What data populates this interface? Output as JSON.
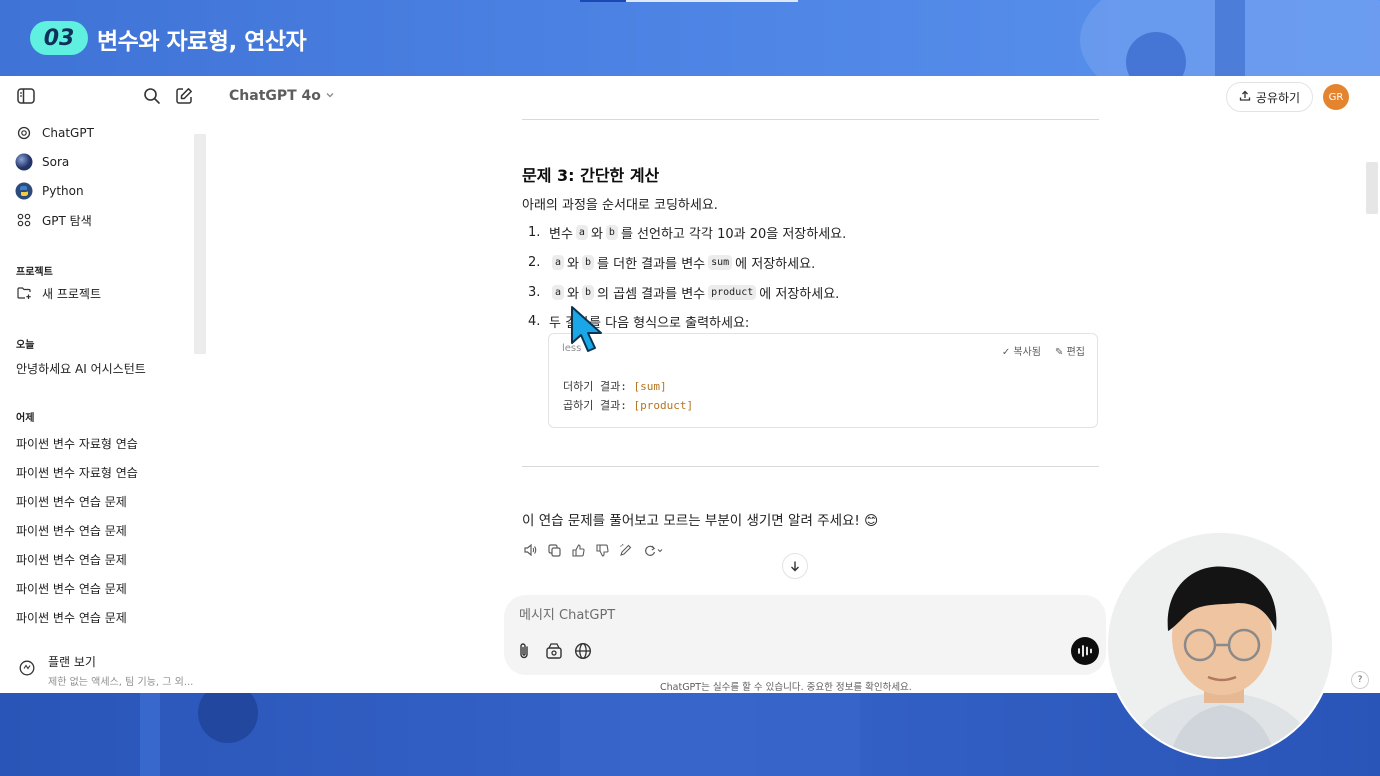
{
  "banner": {
    "badge": "03",
    "title": "변수와 자료형, 연산자"
  },
  "sidebar": {
    "items": [
      {
        "label": "ChatGPT",
        "icon": "openai-icon"
      },
      {
        "label": "Sora",
        "icon": "sora-icon"
      },
      {
        "label": "Python",
        "icon": "python-icon"
      },
      {
        "label": "GPT 탐색",
        "icon": "grid-icon"
      }
    ],
    "projects_heading": "프로젝트",
    "new_project": "새 프로젝트",
    "today_heading": "오늘",
    "today_items": [
      "안녕하세요 AI 어시스턴트"
    ],
    "yesterday_heading": "어제",
    "yesterday_items": [
      "파이썬 변수 자료형 연습",
      "파이썬 변수 자료형 연습",
      "파이썬 변수 연습 문제",
      "파이썬 변수 연습 문제",
      "파이썬 변수 연습 문제",
      "파이썬 변수 연습 문제",
      "파이썬 변수 연습 문제"
    ],
    "plan": {
      "title": "플랜 보기",
      "subtitle": "제한 없는 액세스, 팀 기능, 그 외..."
    }
  },
  "topbar": {
    "model": "ChatGPT 4o",
    "share": "공유하기",
    "avatar": "GR"
  },
  "content": {
    "heading": "문제 3: 간단한 계산",
    "intro": "아래의 과정을 순서대로 코딩하세요.",
    "steps": [
      {
        "num": "1.",
        "pre": "변수",
        "c1": "a",
        "mid": "와",
        "c2": "b",
        "post": "를 선언하고 각각 10과 20을 저장하세요."
      },
      {
        "num": "2.",
        "c1": "a",
        "mid": "와",
        "c2": "b",
        "post1": "를 더한 결과를 변수",
        "c3": "sum",
        "post2": "에 저장하세요."
      },
      {
        "num": "3.",
        "c1": "a",
        "mid": "와",
        "c2": "b",
        "post1": "의 곱셈 결과를 변수",
        "c3": "product",
        "post2": "에 저장하세요."
      },
      {
        "num": "4.",
        "text": "두 결과를 다음 형식으로 출력하세요:"
      }
    ],
    "code": {
      "lang": "less",
      "copy": "복사됨",
      "edit": "편집",
      "line1_label": "더하기 결과: ",
      "line1_ph": "[sum]",
      "line2_label": "곱하기 결과: ",
      "line2_ph": "[product]"
    },
    "closing": "이 연습 문제를 풀어보고 모르는 부분이 생기면 알려 주세요! 😊"
  },
  "composer": {
    "placeholder": "메시지 ChatGPT"
  },
  "disclaimer": "ChatGPT는 실수를 할 수 있습니다. 중요한 정보를 확인하세요.",
  "help": "?",
  "colors": {
    "banner": "#4f86e6",
    "badge": "#5ff0e0",
    "avatar": "#e5842f",
    "cursor": "#1aa7e8"
  }
}
